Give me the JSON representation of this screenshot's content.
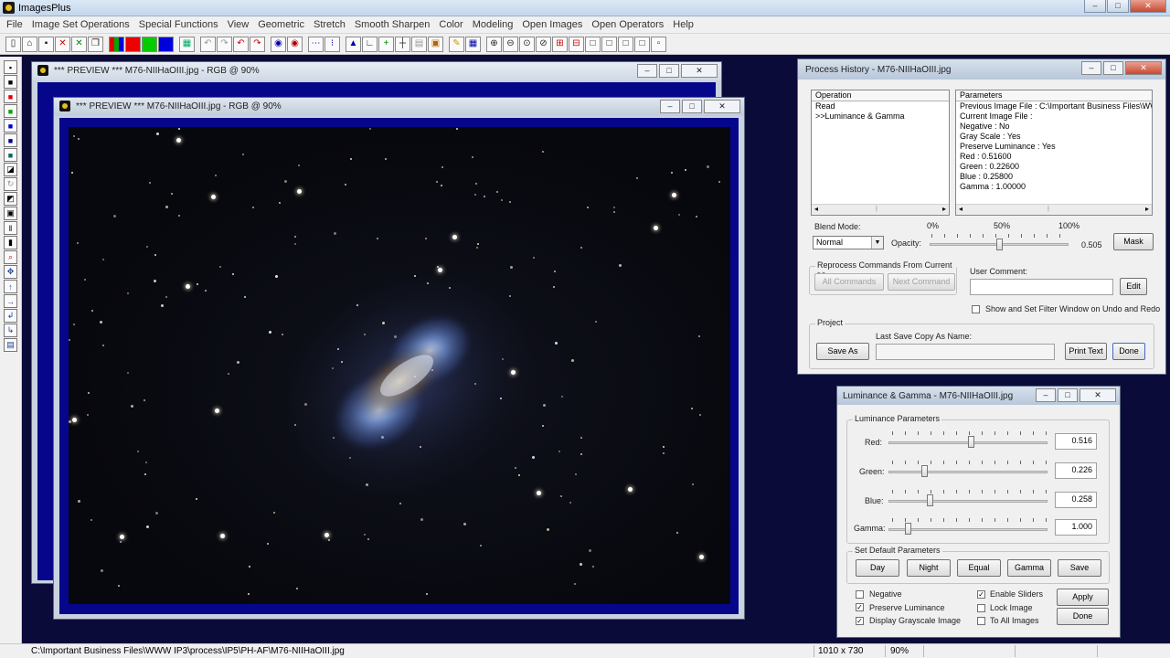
{
  "app": {
    "title": "ImagesPlus"
  },
  "menu": [
    "File",
    "Image Set Operations",
    "Special Functions",
    "View",
    "Geometric",
    "Stretch",
    "Smooth Sharpen",
    "Color",
    "Modeling",
    "Open Images",
    "Open Operators",
    "Help"
  ],
  "preview_back": {
    "title": "*** PREVIEW *** M76-NIIHaOIII.jpg - RGB @ 90%"
  },
  "preview_front": {
    "title": "*** PREVIEW *** M76-NIIHaOIII.jpg - RGB @ 90%"
  },
  "process_history": {
    "title": "Process History - M76-NIIHaOIII.jpg",
    "operation_header": "Operation",
    "operations": [
      "Read",
      ">>Luminance & Gamma"
    ],
    "parameters_header": "Parameters",
    "parameters": [
      "Previous Image File : C:\\Important Business Files\\WW...",
      "Current Image File :",
      "Negative : No",
      "Gray Scale : Yes",
      "Preserve Luminance : Yes",
      "Red : 0.51600",
      "Green : 0.22600",
      "Blue : 0.25800",
      "Gamma : 1.00000"
    ],
    "blend_mode_label": "Blend Mode:",
    "blend_mode_value": "Normal",
    "opacity_label": "Opacity:",
    "pct_0": "0%",
    "pct_50": "50%",
    "pct_100": "100%",
    "opacity_value": "0.505",
    "opacity_fraction": 0.505,
    "mask_button": "Mask",
    "reprocess_label": "Reprocess Commands From Current >>",
    "all_commands": "All Commands",
    "next_command": "Next Command",
    "user_comment_label": "User Comment:",
    "user_comment_value": "",
    "edit_button": "Edit",
    "show_filter_label": "Show and Set Filter Window on Undo and Redo",
    "show_filter_checked": false,
    "project_label": "Project",
    "last_save_label": "Last Save Copy As Name:",
    "save_as_button": "Save As",
    "last_save_value": "",
    "print_text_button": "Print Text",
    "done_button": "Done"
  },
  "luminance_gamma": {
    "title": "Luminance & Gamma - M76-NIIHaOIII.jpg",
    "group_label": "Luminance Parameters",
    "sliders": [
      {
        "label": "Red:",
        "value": "0.516",
        "fraction": 0.516
      },
      {
        "label": "Green:",
        "value": "0.226",
        "fraction": 0.226
      },
      {
        "label": "Blue:",
        "value": "0.258",
        "fraction": 0.258
      },
      {
        "label": "Gamma:",
        "value": "1.000",
        "fraction": 0.12
      }
    ],
    "defaults_label": "Set Default Parameters",
    "default_buttons": [
      "Day",
      "Night",
      "Equal",
      "Gamma",
      "Save"
    ],
    "negative_label": "Negative",
    "negative_checked": false,
    "preserve_label": "Preserve Luminance",
    "preserve_checked": true,
    "grayscale_label": "Display Grayscale Image",
    "grayscale_checked": true,
    "enable_sliders_label": "Enable Sliders",
    "enable_sliders_checked": true,
    "lock_image_label": "Lock Image",
    "lock_image_checked": false,
    "to_all_label": "To All Images",
    "to_all_checked": false,
    "apply_button": "Apply",
    "done_button": "Done"
  },
  "status": {
    "path": "C:\\Important Business Files\\WWW IP3\\process\\IP5\\PH-AF\\M76-NIIHaOIII.jpg",
    "dimensions": "1010 x 730",
    "zoom": "90%"
  },
  "colors": {
    "mdi_background": "#0b0b3a",
    "image_border": "#06068a",
    "nebula_blue": "#6f8fd0",
    "nebula_gold": "#c9a86a"
  }
}
